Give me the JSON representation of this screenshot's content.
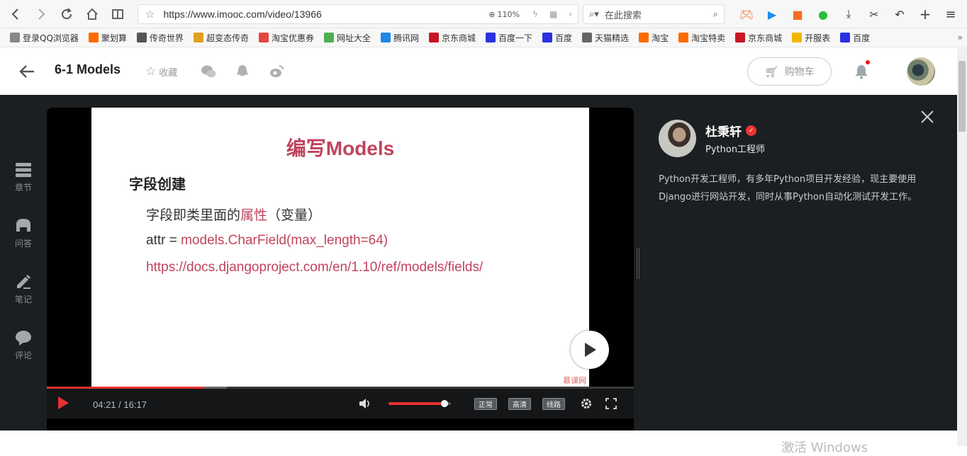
{
  "browser": {
    "url": "https://www.imooc.com/video/13966",
    "zoom": "110%",
    "search_placeholder": "在此搜索"
  },
  "bookmarks": [
    {
      "label": "登录QQ浏览器",
      "icon": "user-icon",
      "color": "#888888"
    },
    {
      "label": "聚划算",
      "icon": "taobao-icon",
      "color": "#ff6a00"
    },
    {
      "label": "传奇世界",
      "icon": "game-icon",
      "color": "#555555"
    },
    {
      "label": "超变态传奇",
      "icon": "game-icon",
      "color": "#e0a020"
    },
    {
      "label": "淘宝优惠券",
      "icon": "coupon-icon",
      "color": "#e2483d"
    },
    {
      "label": "网址大全",
      "icon": "hao-icon",
      "color": "#4caf50"
    },
    {
      "label": "腾讯网",
      "icon": "tencent-icon",
      "color": "#1e88e5"
    },
    {
      "label": "京东商城",
      "icon": "jd-icon",
      "color": "#c91623"
    },
    {
      "label": "百度一下",
      "icon": "baidu-icon",
      "color": "#2932e1"
    },
    {
      "label": "百度",
      "icon": "baidu-icon",
      "color": "#2932e1"
    },
    {
      "label": "天猫精选",
      "icon": "globe-icon",
      "color": "#666666"
    },
    {
      "label": "淘宝",
      "icon": "taobao-icon",
      "color": "#ff6a00"
    },
    {
      "label": "淘宝特卖",
      "icon": "taobao-icon",
      "color": "#ff6a00"
    },
    {
      "label": "京东商城",
      "icon": "jd-icon",
      "color": "#c91623"
    },
    {
      "label": "开服表",
      "icon": "smile-icon",
      "color": "#f2b600"
    },
    {
      "label": "百度",
      "icon": "baidu-icon",
      "color": "#2932e1"
    }
  ],
  "header": {
    "title": "6-1 Models",
    "favorite_label": "收藏",
    "cart_label": "购物车"
  },
  "side_nav": [
    {
      "label": "章节",
      "icon": "chapter-icon"
    },
    {
      "label": "问答",
      "icon": "qa-icon"
    },
    {
      "label": "笔记",
      "icon": "note-icon"
    },
    {
      "label": "评论",
      "icon": "comment-icon"
    }
  ],
  "slide": {
    "title": "编写Models",
    "heading": "字段创建",
    "line1_prefix": "字段即类里面的",
    "line1_highlight": "属性",
    "line1_suffix": "（变量）",
    "line2_prefix": "attr = ",
    "line2_code": "models.CharField(max_length=64)",
    "line3_link": "https://docs.djangoproject.com/en/1.10/ref/models/fields/",
    "logo": "慕课网"
  },
  "player": {
    "current_time": "04:21",
    "total_time": "16:17",
    "progress": 0.268,
    "volume": 0.9,
    "quality_normal": "正常",
    "quality_hd": "高清",
    "route": "线路"
  },
  "teacher": {
    "name": "杜秉轩",
    "title": "Python工程师",
    "description": "Python开发工程师，有多年Python项目开发经验，现主要使用Django进行网站开发，同时从事Python自动化测试开发工作。"
  },
  "colors": {
    "accent": "#e83131",
    "slide_highlight": "#c0435d",
    "dark_bg": "#1c1f21"
  },
  "os_watermark": "激活 Windows"
}
